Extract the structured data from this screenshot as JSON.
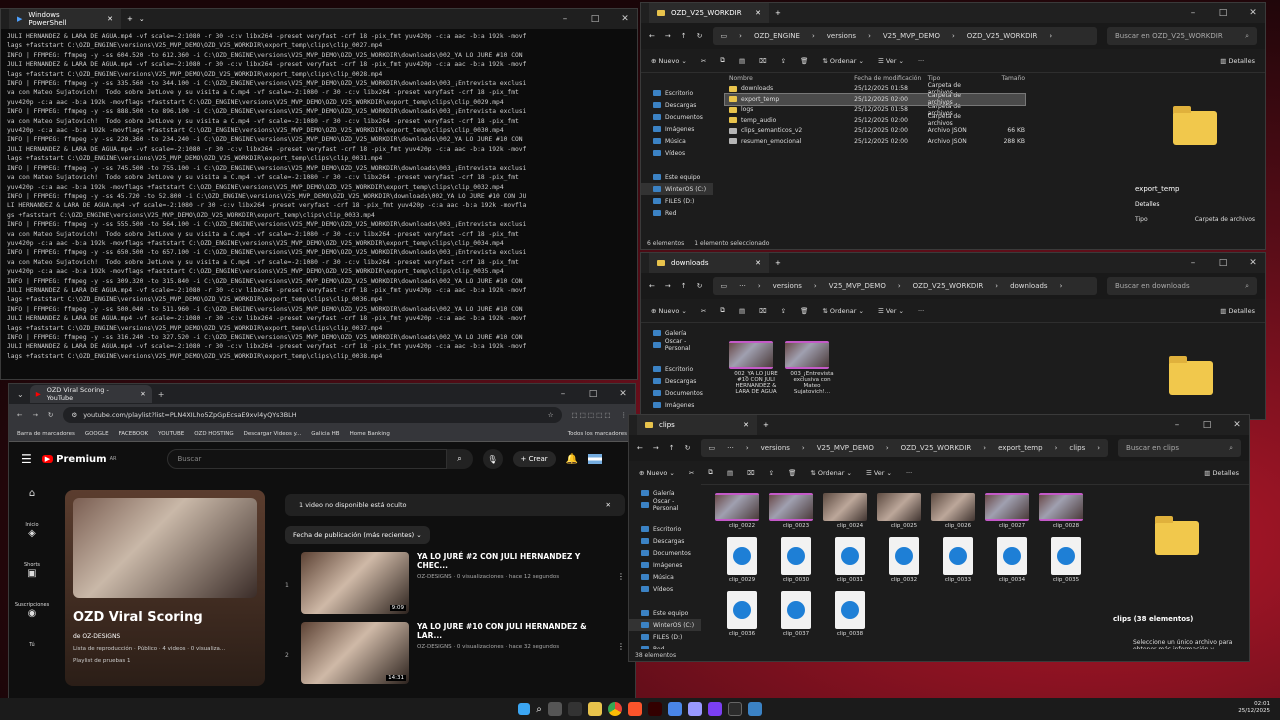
{
  "powershell": {
    "title": "Windows PowerShell",
    "lines": [
      "JULI HERNANDEZ & LARA DE AGUA.mp4 -vf scale=-2:1080 -r 30 -c:v libx264 -preset veryfast -crf 18 -pix_fmt yuv420p -c:a aac -b:a 192k -movf",
      "lags +faststart C:\\OZD_ENGINE\\versions\\V25_MVP_DEMO\\OZD_V25_WORKDIR\\export_temp\\clips\\clip_0027.mp4",
      "INFO | FFMPEG: ffmpeg -y -ss 604.520 -to 612.360 -i C:\\OZD_ENGINE\\versions\\V25_MVP_DEMO\\OZD_V25_WORKDIR\\downloads\\002_YA LO JURE #10 CON",
      "JULI HERNANDEZ & LARA DE AGUA.mp4 -vf scale=-2:1080 -r 30 -c:v libx264 -preset veryfast -crf 18 -pix_fmt yuv420p -c:a aac -b:a 192k -movf",
      "lags +faststart C:\\OZD_ENGINE\\versions\\V25_MVP_DEMO\\OZD_V25_WORKDIR\\export_temp\\clips\\clip_0028.mp4",
      "INFO | FFMPEG: ffmpeg -y -ss 335.560 -to 344.100 -i C:\\OZD_ENGINE\\versions\\V25_MVP_DEMO\\OZD_V25_WORKDIR\\downloads\\003_¡Entrevista exclusi",
      "va con Mateo Sujatovich!  Todo sobre JetLove y su visita a C.mp4 -vf scale=-2:1080 -r 30 -c:v libx264 -preset veryfast -crf 18 -pix_fmt",
      "yuv420p -c:a aac -b:a 192k -movflags +faststart C:\\OZD_ENGINE\\versions\\V25_MVP_DEMO\\OZD_V25_WORKDIR\\export_temp\\clips\\clip_0029.mp4",
      "INFO | FFMPEG: ffmpeg -y -ss 888.500 -to 896.100 -i C:\\OZD_ENGINE\\versions\\V25_MVP_DEMO\\OZD_V25_WORKDIR\\downloads\\003_¡Entrevista exclusi",
      "va con Mateo Sujatovich!  Todo sobre JetLove y su visita a C.mp4 -vf scale=-2:1080 -r 30 -c:v libx264 -preset veryfast -crf 18 -pix_fmt",
      "yuv420p -c:a aac -b:a 192k -movflags +faststart C:\\OZD_ENGINE\\versions\\V25_MVP_DEMO\\OZD_V25_WORKDIR\\export_temp\\clips\\clip_0030.mp4",
      "INFO | FFMPEG: ffmpeg -y -ss 220.360 -to 234.240 -i C:\\OZD_ENGINE\\versions\\V25_MVP_DEMO\\OZD_V25_WORKDIR\\downloads\\002_YA LO JURE #10 CON",
      "JULI HERNANDEZ & LARA DE AGUA.mp4 -vf scale=-2:1080 -r 30 -c:v libx264 -preset veryfast -crf 18 -pix_fmt yuv420p -c:a aac -b:a 192k -movf",
      "lags +faststart C:\\OZD_ENGINE\\versions\\V25_MVP_DEMO\\OZD_V25_WORKDIR\\export_temp\\clips\\clip_0031.mp4",
      "INFO | FFMPEG: ffmpeg -y -ss 745.500 -to 755.100 -i C:\\OZD_ENGINE\\versions\\V25_MVP_DEMO\\OZD_V25_WORKDIR\\downloads\\003_¡Entrevista exclusi",
      "va con Mateo Sujatovich!  Todo sobre JetLove y su visita a C.mp4 -vf scale=-2:1080 -r 30 -c:v libx264 -preset veryfast -crf 18 -pix_fmt",
      "yuv420p -c:a aac -b:a 192k -movflags +faststart C:\\OZD_ENGINE\\versions\\V25_MVP_DEMO\\OZD_V25_WORKDIR\\export_temp\\clips\\clip_0032.mp4",
      "INFO | FFMPEG: ffmpeg -y -ss 45.720 -to 52.800 -i C:\\OZD_ENGINE\\versions\\V25_MVP_DEMO\\OZD_V25_WORKDIR\\downloads\\002_YA LO JURE #10 CON JU",
      "LI HERNANDEZ & LARA DE AGUA.mp4 -vf scale=-2:1080 -r 30 -c:v libx264 -preset veryfast -crf 18 -pix_fmt yuv420p -c:a aac -b:a 192k -movfla",
      "gs +faststart C:\\OZD_ENGINE\\versions\\V25_MVP_DEMO\\OZD_V25_WORKDIR\\export_temp\\clips\\clip_0033.mp4",
      "INFO | FFMPEG: ffmpeg -y -ss 555.500 -to 564.100 -i C:\\OZD_ENGINE\\versions\\V25_MVP_DEMO\\OZD_V25_WORKDIR\\downloads\\003_¡Entrevista exclusi",
      "va con Mateo Sujatovich!  Todo sobre JetLove y su visita a C.mp4 -vf scale=-2:1080 -r 30 -c:v libx264 -preset veryfast -crf 18 -pix_fmt",
      "yuv420p -c:a aac -b:a 192k -movflags +faststart C:\\OZD_ENGINE\\versions\\V25_MVP_DEMO\\OZD_V25_WORKDIR\\export_temp\\clips\\clip_0034.mp4",
      "INFO | FFMPEG: ffmpeg -y -ss 650.500 -to 657.100 -i C:\\OZD_ENGINE\\versions\\V25_MVP_DEMO\\OZD_V25_WORKDIR\\downloads\\003_¡Entrevista exclusi",
      "va con Mateo Sujatovich!  Todo sobre JetLove y su visita a C.mp4 -vf scale=-2:1080 -r 30 -c:v libx264 -preset veryfast -crf 18 -pix_fmt",
      "yuv420p -c:a aac -b:a 192k -movflags +faststart C:\\OZD_ENGINE\\versions\\V25_MVP_DEMO\\OZD_V25_WORKDIR\\export_temp\\clips\\clip_0035.mp4",
      "INFO | FFMPEG: ffmpeg -y -ss 309.320 -to 315.840 -i C:\\OZD_ENGINE\\versions\\V25_MVP_DEMO\\OZD_V25_WORKDIR\\downloads\\002_YA LO JURE #10 CON",
      "JULI HERNANDEZ & LARA DE AGUA.mp4 -vf scale=-2:1080 -r 30 -c:v libx264 -preset veryfast -crf 18 -pix_fmt yuv420p -c:a aac -b:a 192k -movf",
      "lags +faststart C:\\OZD_ENGINE\\versions\\V25_MVP_DEMO\\OZD_V25_WORKDIR\\export_temp\\clips\\clip_0036.mp4",
      "INFO | FFMPEG: ffmpeg -y -ss 500.040 -to 511.960 -i C:\\OZD_ENGINE\\versions\\V25_MVP_DEMO\\OZD_V25_WORKDIR\\downloads\\002_YA LO JURE #10 CON",
      "JULI HERNANDEZ & LARA DE AGUA.mp4 -vf scale=-2:1080 -r 30 -c:v libx264 -preset veryfast -crf 18 -pix_fmt yuv420p -c:a aac -b:a 192k -movf",
      "lags +faststart C:\\OZD_ENGINE\\versions\\V25_MVP_DEMO\\OZD_V25_WORKDIR\\export_temp\\clips\\clip_0037.mp4",
      "INFO | FFMPEG: ffmpeg -y -ss 316.240 -to 327.520 -i C:\\OZD_ENGINE\\versions\\V25_MVP_DEMO\\OZD_V25_WORKDIR\\downloads\\002_YA LO JURE #10 CON",
      "JULI HERNANDEZ & LARA DE AGUA.mp4 -vf scale=-2:1080 -r 30 -c:v libx264 -preset veryfast -crf 18 -pix_fmt yuv420p -c:a aac -b:a 192k -movf",
      "lags +faststart C:\\OZD_ENGINE\\versions\\V25_MVP_DEMO\\OZD_V25_WORKDIR\\export_temp\\clips\\clip_0038.mp4"
    ]
  },
  "explorer_workdir": {
    "tab": "OZD_V25_WORKDIR",
    "crumbs": [
      "OZD_ENGINE",
      "versions",
      "V25_MVP_DEMO",
      "OZD_V25_WORKDIR"
    ],
    "search": "Buscar en OZD_V25_WORKDIR",
    "nuevo": "Nuevo",
    "ordenar": "Ordenar",
    "ver": "Ver",
    "detalles": "Detalles",
    "columns": [
      "Nombre",
      "Fecha de modificación",
      "Tipo",
      "Tamaño"
    ],
    "nav": [
      "Escritorio",
      "Descargas",
      "Documentos",
      "Imágenes",
      "Música",
      "Vídeos",
      "",
      "Este equipo",
      "WinterOS (C:)",
      "FILES (D:)",
      "Red"
    ],
    "rows": [
      {
        "name": "downloads",
        "date": "25/12/2025 01:58",
        "type": "Carpeta de archivos",
        "size": ""
      },
      {
        "name": "export_temp",
        "date": "25/12/2025 02:00",
        "type": "Carpeta de archivos",
        "size": ""
      },
      {
        "name": "logs",
        "date": "25/12/2025 01:58",
        "type": "Carpeta de archivos",
        "size": ""
      },
      {
        "name": "temp_audio",
        "date": "25/12/2025 02:00",
        "type": "Carpeta de archivos",
        "size": ""
      },
      {
        "name": "clips_semanticos_v2",
        "date": "25/12/2025 02:00",
        "type": "Archivo JSON",
        "size": "66 KB"
      },
      {
        "name": "resumen_emocional",
        "date": "25/12/2025 02:00",
        "type": "Archivo JSON",
        "size": "288 KB"
      }
    ],
    "status": [
      "6 elementos",
      "1 elemento seleccionado"
    ],
    "detail_name": "export_temp",
    "detail_label": "Detalles",
    "detail_key": "Tipo",
    "detail_val": "Carpeta de archivos"
  },
  "explorer_downloads": {
    "tab": "downloads",
    "crumbs": [
      "versions",
      "V25_MVP_DEMO",
      "OZD_V25_WORKDIR",
      "downloads"
    ],
    "search": "Buscar en downloads",
    "nuevo": "Nuevo",
    "ordenar": "Ordenar",
    "ver": "Ver",
    "detalles": "Detalles",
    "nav": [
      "Galería",
      "Oscar - Personal",
      "",
      "Escritorio",
      "Descargas",
      "Documentos",
      "Imágenes",
      "Música"
    ],
    "files": [
      "002_YA LO JURE #10 CON JULI HERNANDEZ & LARA DE AGUA",
      "003_¡Entrevista exclusiva con Mateo Sujatovich!..."
    ]
  },
  "explorer_clips": {
    "tab": "clips",
    "crumbs": [
      "versions",
      "V25_MVP_DEMO",
      "OZD_V25_WORKDIR",
      "export_temp",
      "clips"
    ],
    "search": "Buscar en clips",
    "nuevo": "Nuevo",
    "ordenar": "Ordenar",
    "ver": "Ver",
    "detalles": "Detalles",
    "nav": [
      "Galería",
      "Oscar - Personal",
      "",
      "Escritorio",
      "Descargas",
      "Documentos",
      "Imágenes",
      "Música",
      "Vídeos",
      "",
      "Este equipo",
      "WinterOS (C:)",
      "FILES (D:)",
      "Red"
    ],
    "row1": [
      "clip_0022",
      "clip_0023",
      "clip_0024",
      "clip_0025",
      "clip_0026",
      "clip_0027",
      "clip_0028"
    ],
    "row2": [
      "clip_0029",
      "clip_0030",
      "clip_0031",
      "clip_0032",
      "clip_0033",
      "clip_0034",
      "clip_0035"
    ],
    "row3": [
      "clip_0036",
      "clip_0037",
      "clip_0038"
    ],
    "status": "38 elementos",
    "detail_title": "clips (38 elementos)",
    "detail_hint": "Seleccione un único archivo para obtener más información y"
  },
  "browser": {
    "tab_title": "OZD Viral Scoring - YouTube",
    "url": "youtube.com/playlist?list=PLN4XILho5ZpGpEcsaE9xvl4yQYs3BLH",
    "bookmarks": [
      "Barra de marcadores",
      "GOOGLE",
      "FACEBOOK",
      "YOUTUBE",
      "OZD HOSTING",
      "Descargar Videos y...",
      "Galicia HB",
      "Home Banking"
    ],
    "all_bookmarks": "Todos los marcadores",
    "logo": "Premium",
    "logo_sup": "AR",
    "search_placeholder": "Buscar",
    "create": "Crear",
    "side": [
      "Inicio",
      "Shorts",
      "Suscripciones",
      "Tú"
    ],
    "playlist_title": "OZD Viral Scoring",
    "owner": "de OZ-DESIGNS",
    "meta": "Lista de reproducción · Público · 4 videos · 0 visualiza...",
    "desc": "Playlist de pruebas 1",
    "banner": "1 video no disponible está oculto",
    "sort": "Fecha de publicación (más recientes)",
    "videos": [
      {
        "num": "1",
        "title": "YA LO JURÉ #2 CON JULI HERNANDEZ Y CHEC...",
        "sub": "OZ-DESIGNS · 0 visualizaciones · hace 12 segundos",
        "dur": "9:09"
      },
      {
        "num": "2",
        "title": "YA LO JURE #10 CON JULI HERNANDEZ & LAR...",
        "sub": "OZ-DESIGNS · 0 visualizaciones · hace 32 segundos",
        "dur": "14:31"
      }
    ]
  },
  "clock": {
    "time": "02:01",
    "date": "25/12/2025"
  }
}
